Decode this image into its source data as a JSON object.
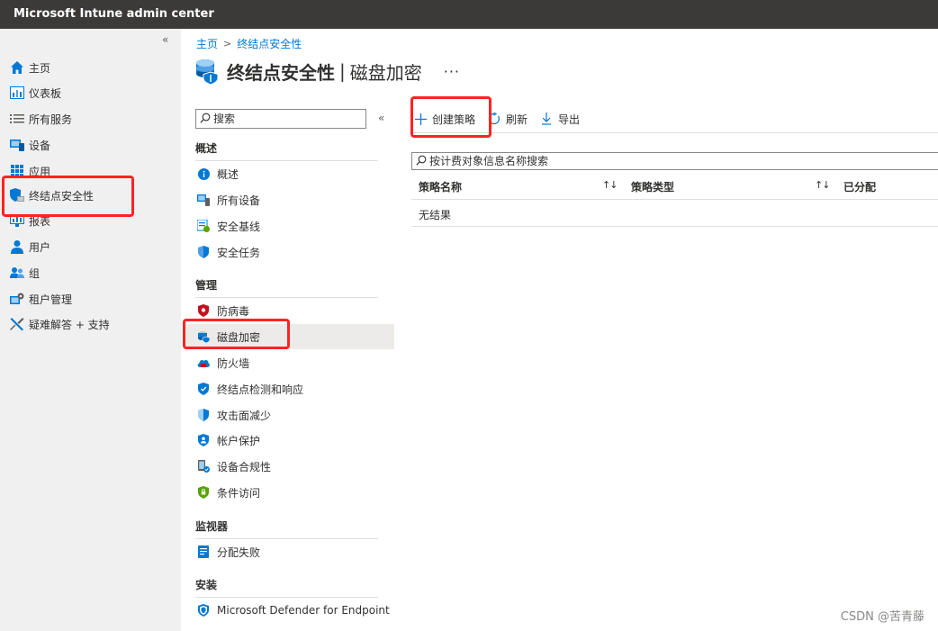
{
  "app": {
    "title": "Microsoft Intune admin center"
  },
  "leftnav": {
    "collapse": "«",
    "items": [
      {
        "label": "主页",
        "icon": "home-icon"
      },
      {
        "label": "仪表板",
        "icon": "dashboard-icon"
      },
      {
        "label": "所有服务",
        "icon": "list-icon"
      },
      {
        "label": "设备",
        "icon": "devices-icon"
      },
      {
        "label": "应用",
        "icon": "apps-icon"
      },
      {
        "label": "终结点安全性",
        "icon": "endpoint-security-icon"
      },
      {
        "label": "报表",
        "icon": "reports-icon"
      },
      {
        "label": "用户",
        "icon": "user-icon"
      },
      {
        "label": "组",
        "icon": "groups-icon"
      },
      {
        "label": "租户管理",
        "icon": "tenant-admin-icon"
      },
      {
        "label": "疑难解答 + 支持",
        "icon": "troubleshoot-icon"
      }
    ]
  },
  "breadcrumb": {
    "home": "主页",
    "sep": ">",
    "current": "终结点安全性"
  },
  "header": {
    "title": "终结点安全性",
    "sep": "|",
    "subtitle": "磁盘加密",
    "more": "···"
  },
  "sidemenu": {
    "search_placeholder": "搜索",
    "collapse": "«",
    "sections": [
      {
        "title": "概述",
        "items": [
          "概述",
          "所有设备",
          "安全基线",
          "安全任务"
        ]
      },
      {
        "title": "管理",
        "items": [
          "防病毒",
          "磁盘加密",
          "防火墙",
          "终结点检测和响应",
          "攻击面减少",
          "帐户保护",
          "设备合规性",
          "条件访问"
        ]
      },
      {
        "title": "监视器",
        "items": [
          "分配失败"
        ]
      },
      {
        "title": "安装",
        "items": [
          "Microsoft Defender for Endpoint"
        ]
      }
    ]
  },
  "toolbar": {
    "create": "创建策略",
    "refresh": "刷新",
    "export": "导出"
  },
  "filter": {
    "placeholder": "按计费对象信息名称搜索"
  },
  "table": {
    "columns": [
      "策略名称",
      "策略类型",
      "已分配"
    ],
    "sort_glyph": "↑↓",
    "empty": "无结果"
  },
  "watermark": "CSDN @苦青藤",
  "colors": {
    "accent": "#0078d4",
    "topbar": "#3b3a39",
    "highlight": "#ff2323"
  }
}
